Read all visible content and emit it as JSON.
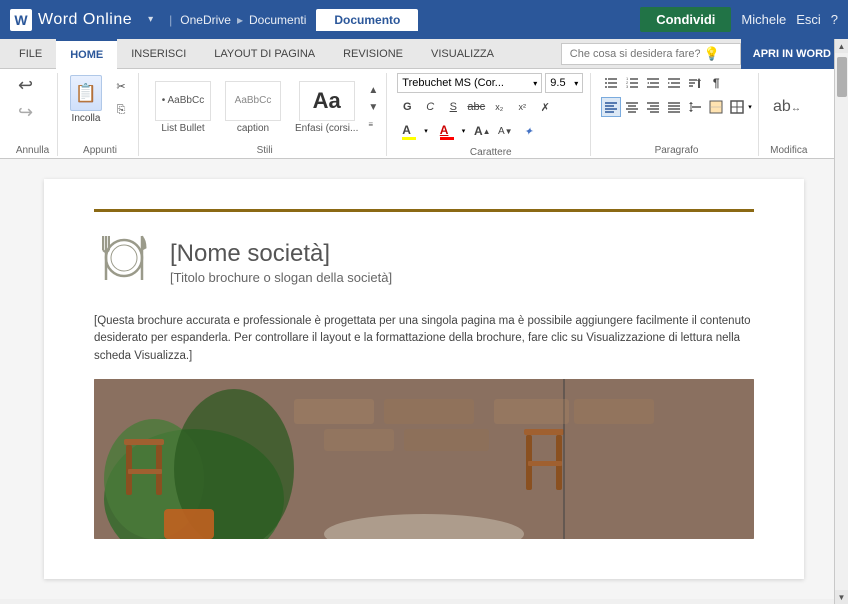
{
  "titlebar": {
    "logo_letter": "W",
    "app_title": "Word Online",
    "dropdown_arrow": "▾",
    "breadcrumb": {
      "part1": "OneDrive",
      "sep": "▸",
      "part2": "Documenti"
    },
    "doc_tab": "Documento",
    "share_btn": "Condividi",
    "user_name": "Michele",
    "sign_out": "Esci",
    "help_btn": "?"
  },
  "ribbon_tabs": {
    "tabs": [
      {
        "id": "file",
        "label": "FILE"
      },
      {
        "id": "home",
        "label": "HOME",
        "active": true
      },
      {
        "id": "inserisci",
        "label": "INSERISCI"
      },
      {
        "id": "layout",
        "label": "LAYOUT DI PAGINA"
      },
      {
        "id": "revisione",
        "label": "REVISIONE"
      },
      {
        "id": "visualizza",
        "label": "VISUALIZZA"
      }
    ],
    "search_placeholder": "Che cosa si desidera fare?",
    "open_word": "APRI IN WORD"
  },
  "ribbon": {
    "groups": {
      "annulla": {
        "label": "Annulla",
        "undo_label": "↩",
        "redo_label": "↪"
      },
      "appunti": {
        "label": "Appunti",
        "paste_label": "Incolla",
        "cut_label": "✂",
        "copy_label": "⎘"
      },
      "stili": {
        "label": "Stili",
        "items": [
          {
            "name": "List Bullet",
            "preview": "• AaBbCc"
          },
          {
            "name": "caption",
            "preview": "AaBbCc"
          },
          {
            "name": "Enfasi (corsi...",
            "preview": "Aa",
            "big": true
          }
        ]
      },
      "carattere": {
        "label": "Carattere",
        "font_name": "Trebuchet MS (Cor...",
        "font_size": "9.5",
        "bold": "G",
        "italic": "C",
        "underline": "S",
        "strikethrough": "abc",
        "subscript": "x₂",
        "superscript": "x²",
        "clear_format": "✗",
        "font_color": "A",
        "highlight": "A",
        "size_up": "A↑",
        "size_down": "A↓"
      },
      "paragrafo": {
        "label": "Paragrafo",
        "list_unordered": "☰",
        "list_ordered": "☰",
        "outdent": "⇤",
        "indent": "⇥",
        "align_left": "≡",
        "align_center": "≡",
        "align_right": "≡",
        "justify": "≡",
        "line_spacing": "↕",
        "shading": "░",
        "borders": "⊞",
        "show_para": "¶",
        "sort": "↕"
      },
      "modifica": {
        "label": "Modifica",
        "icon": "ab↔"
      }
    }
  },
  "document": {
    "company_name": "[Nome società]",
    "company_subtitle": "[Titolo brochure o slogan della società]",
    "body_text": "[Questa brochure accurata e professionale è progettata per una singola pagina ma è possibile aggiungere facilmente il contenuto desiderato per espanderla. Per controllare il layout e la formattazione della brochure, fare clic su Visualizzazione di lettura nella scheda Visualizza.]",
    "restaurant_icon": "🍽"
  }
}
